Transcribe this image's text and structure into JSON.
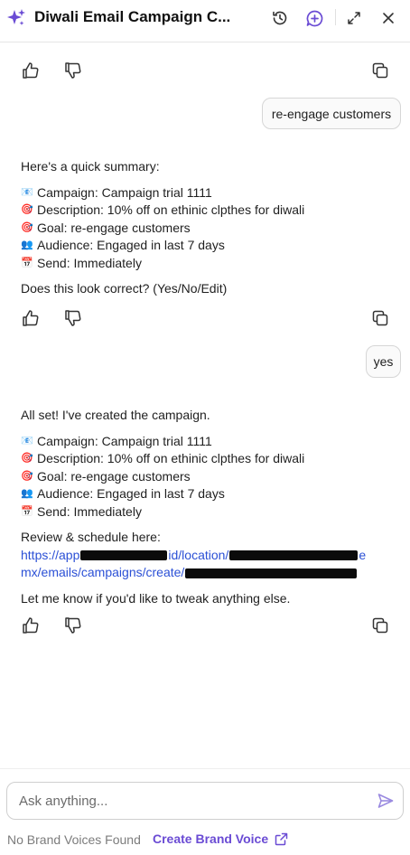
{
  "header": {
    "title": "Diwali Email Campaign C...",
    "icons": [
      "sparkle-icon",
      "history-icon",
      "new-chat-icon",
      "expand-icon",
      "close-icon"
    ],
    "accent": "#6a4bd4"
  },
  "messages": {
    "user1": "re-engage customers",
    "summary": {
      "intro": "Here's a quick summary:",
      "campaign": "Campaign: Campaign trial 1111",
      "description": "Description: 10% off on ethinic clpthes for diwali",
      "goal": "Goal: re-engage customers",
      "audience": "Audience: Engaged in last 7 days",
      "send": "Send: Immediately",
      "question": "Does this look correct? (Yes/No/Edit)"
    },
    "user2": "yes",
    "result": {
      "intro": "All set! I've created the campaign.",
      "campaign": "Campaign: Campaign trial 1111",
      "description": "Description: 10% off on ethinic clpthes for diwali",
      "goal": "Goal: re-engage customers",
      "audience": "Audience: Engaged in last 7 days",
      "send": "Send: Immediately",
      "review_label": "Review & schedule here:",
      "link_part1": "https://app",
      "link_part2": "id/location/",
      "link_part3": "e",
      "link_part4": "mx/emails/campaigns/create/",
      "closing": "Let me know if you'd like to tweak anything else."
    },
    "emoji": {
      "campaign": "📧",
      "description": "🎯",
      "goal": "🎯",
      "audience": "👥",
      "send": "📅"
    }
  },
  "composer": {
    "placeholder": "Ask anything...",
    "no_brand_voices": "No Brand Voices Found",
    "create_brand_voice": "Create Brand Voice"
  },
  "colors": {
    "link": "#2b50d6",
    "brand": "#6a4bd4"
  }
}
